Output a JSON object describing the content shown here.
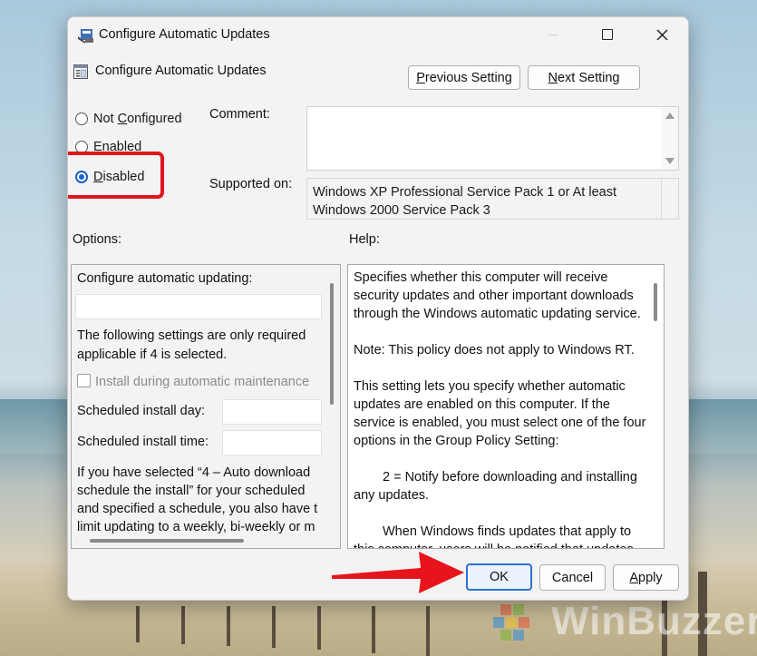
{
  "window": {
    "title": "Configure Automatic Updates",
    "controls": [
      "minimize",
      "maximize",
      "close"
    ]
  },
  "policy": {
    "name": "Configure Automatic Updates",
    "previous_setting": "Previous Setting",
    "previous_setting_mnemonic": "P",
    "previous_setting_rest": "revious Setting",
    "next_setting": "Next Setting",
    "next_setting_mnemonic": "N",
    "next_setting_rest": "ext Setting"
  },
  "state": {
    "options": [
      {
        "label": "Not Configured",
        "pre": "Not ",
        "mnemonic": "C",
        "post": "onfigured",
        "selected": false
      },
      {
        "label": "Enabled",
        "pre": "",
        "mnemonic": "E",
        "post": "nabled",
        "selected": false
      },
      {
        "label": "Disabled",
        "pre": "",
        "mnemonic": "D",
        "post": "isabled",
        "selected": true
      }
    ],
    "highlight_color": "#e0161c"
  },
  "comment": {
    "label": "Comment:",
    "value": ""
  },
  "supported": {
    "label": "Supported on:",
    "line1": "Windows XP Professional Service Pack 1 or At least",
    "line2": "Windows 2000 Service Pack 3"
  },
  "options_panel": {
    "label": "Options:",
    "configure_label": "Configure automatic updating:",
    "note_line1": "The following settings are only required",
    "note_line2": "applicable if 4 is selected.",
    "maintenance_checkbox": "Install during automatic maintenance",
    "install_day_label": "Scheduled install day:",
    "install_time_label": "Scheduled install time:",
    "para_line1": "If you have selected “4 – Auto download",
    "para_line2": "schedule the install” for your scheduled",
    "para_line3": "and specified a schedule, you also have t",
    "para_line4": "limit updating to a weekly, bi-weekly or m"
  },
  "help_panel": {
    "label": "Help:",
    "p1": "Specifies whether this computer will receive security updates and other important downloads through the Windows automatic updating service.",
    "p2": "Note: This policy does not apply to Windows RT.",
    "p3": "This setting lets you specify whether automatic updates are enabled on this computer. If the service is enabled, you must select one of the four options in the Group Policy Setting:",
    "p4": "2 = Notify before downloading and installing any updates.",
    "p5": "When Windows finds updates that apply to this computer, users will be notified that updates"
  },
  "footer": {
    "ok": "OK",
    "cancel": "Cancel",
    "apply": "Apply",
    "apply_mnemonic": "A",
    "apply_rest": "pply"
  },
  "annotation": {
    "arrow_color": "#e8141c"
  },
  "watermark": {
    "text": "WinBuzzer"
  }
}
